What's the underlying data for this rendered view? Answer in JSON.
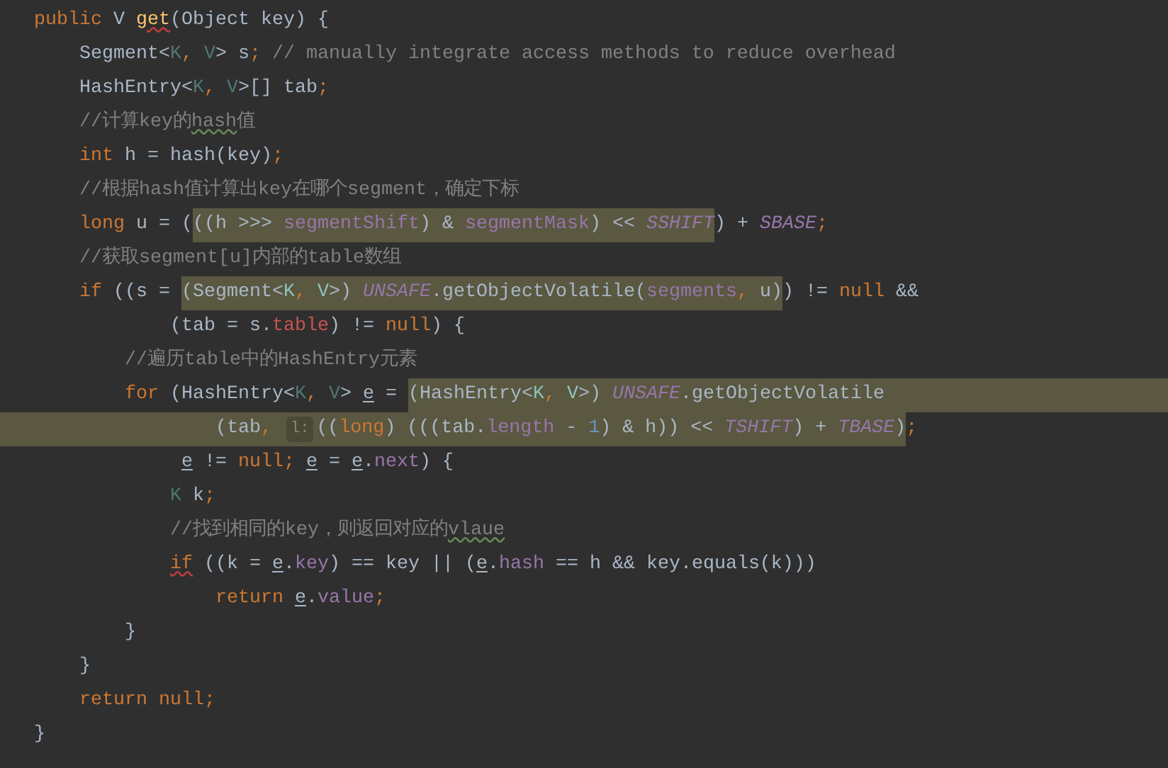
{
  "editor": {
    "lines": [
      {
        "tokens": [
          {
            "text": "public",
            "kind": "keyword"
          },
          {
            "text": " V ",
            "kind": "plain"
          },
          {
            "text": "get",
            "kind": "method_error"
          },
          {
            "text": "(Object key) {",
            "kind": "plain"
          }
        ]
      },
      {
        "tokens": [
          {
            "text": "    Segment<",
            "kind": "plain"
          },
          {
            "text": "K",
            "kind": "generic"
          },
          {
            "text": ", ",
            "kind": "keyword"
          },
          {
            "text": "V",
            "kind": "generic"
          },
          {
            "text": "> s",
            "kind": "plain"
          },
          {
            "text": ";",
            "kind": "keyword"
          },
          {
            "text": " // manually integrate access methods to reduce overhead",
            "kind": "comment"
          }
        ]
      },
      {
        "tokens": [
          {
            "text": "    HashEntry<",
            "kind": "plain"
          },
          {
            "text": "K",
            "kind": "generic"
          },
          {
            "text": ", ",
            "kind": "keyword"
          },
          {
            "text": "V",
            "kind": "generic"
          },
          {
            "text": ">[] tab",
            "kind": "plain"
          },
          {
            "text": ";",
            "kind": "keyword"
          }
        ]
      },
      {
        "tokens": [
          {
            "text": "    //计算key的",
            "kind": "comment"
          },
          {
            "text": "hash",
            "kind": "comment_typo"
          },
          {
            "text": "值",
            "kind": "comment"
          }
        ]
      },
      {
        "tokens": [
          {
            "text": "    int",
            "kind": "keyword"
          },
          {
            "text": " h = hash(key)",
            "kind": "plain"
          },
          {
            "text": ";",
            "kind": "keyword"
          }
        ]
      },
      {
        "tokens": [
          {
            "text": "    //根据hash值计算出key在哪个segment，确定下标",
            "kind": "comment"
          }
        ]
      },
      {
        "tokens": [
          {
            "text": "    long",
            "kind": "keyword"
          },
          {
            "text": " u = (",
            "kind": "plain"
          },
          {
            "kind": "highlight",
            "extends": false,
            "from_edge": false,
            "tokens": [
              {
                "text": "((h >>> ",
                "kind": "plain"
              },
              {
                "text": "segmentShift",
                "kind": "field"
              },
              {
                "text": ") & ",
                "kind": "plain"
              },
              {
                "text": "segmentMask",
                "kind": "field"
              },
              {
                "text": ") << ",
                "kind": "plain"
              },
              {
                "text": "SSHIFT",
                "kind": "static"
              }
            ]
          },
          {
            "text": ") + ",
            "kind": "plain"
          },
          {
            "text": "SBASE",
            "kind": "static"
          },
          {
            "text": ";",
            "kind": "keyword"
          }
        ]
      },
      {
        "tokens": [
          {
            "text": "    //获取segment[u]内部的table数组",
            "kind": "comment"
          }
        ]
      },
      {
        "tokens": [
          {
            "text": "    if",
            "kind": "keyword"
          },
          {
            "text": " ((s = ",
            "kind": "plain"
          },
          {
            "kind": "highlight",
            "extends": false,
            "from_edge": false,
            "tokens": [
              {
                "text": "(Segment<",
                "kind": "plain"
              },
              {
                "text": "K",
                "kind": "generic"
              },
              {
                "text": ", ",
                "kind": "keyword"
              },
              {
                "text": "V",
                "kind": "generic"
              },
              {
                "text": ">) ",
                "kind": "plain"
              },
              {
                "text": "UNSAFE",
                "kind": "static"
              },
              {
                "text": ".getObjectVolatile(",
                "kind": "plain"
              },
              {
                "text": "segments",
                "kind": "field"
              },
              {
                "text": ", ",
                "kind": "keyword"
              },
              {
                "text": "u)",
                "kind": "plain"
              }
            ]
          },
          {
            "text": ") != ",
            "kind": "plain"
          },
          {
            "text": "null",
            "kind": "keyword"
          },
          {
            "text": " &&",
            "kind": "plain"
          }
        ]
      },
      {
        "tokens": [
          {
            "text": "            (tab = s.",
            "kind": "plain"
          },
          {
            "text": "table",
            "kind": "field_red"
          },
          {
            "text": ") != ",
            "kind": "plain"
          },
          {
            "text": "null",
            "kind": "keyword"
          },
          {
            "text": ") {",
            "kind": "plain"
          }
        ]
      },
      {
        "tokens": [
          {
            "text": "        //遍历table中的HashEntry元素",
            "kind": "comment"
          }
        ]
      },
      {
        "tokens": [
          {
            "text": "        for",
            "kind": "keyword"
          },
          {
            "text": " (HashEntry<",
            "kind": "plain"
          },
          {
            "text": "K",
            "kind": "generic"
          },
          {
            "text": ", ",
            "kind": "keyword"
          },
          {
            "text": "V",
            "kind": "generic"
          },
          {
            "text": "> ",
            "kind": "plain"
          },
          {
            "text": "e",
            "kind": "variable"
          },
          {
            "text": " = ",
            "kind": "plain"
          },
          {
            "kind": "highlight",
            "extends": true,
            "from_edge": false,
            "tokens": [
              {
                "text": "(HashEntry<",
                "kind": "plain"
              },
              {
                "text": "K",
                "kind": "generic"
              },
              {
                "text": ", ",
                "kind": "keyword"
              },
              {
                "text": "V",
                "kind": "generic"
              },
              {
                "text": ">) ",
                "kind": "plain"
              },
              {
                "text": "UNSAFE",
                "kind": "static"
              },
              {
                "text": ".getObjectVolatile",
                "kind": "plain"
              }
            ]
          }
        ]
      },
      {
        "tokens": [
          {
            "kind": "highlight",
            "extends": false,
            "from_edge": true,
            "tokens": [
              {
                "text": "                (tab",
                "kind": "plain"
              },
              {
                "text": ", ",
                "kind": "keyword"
              },
              {
                "text": "l:",
                "kind": "hint"
              },
              {
                "text": "((",
                "kind": "plain"
              },
              {
                "text": "long",
                "kind": "keyword"
              },
              {
                "text": ") (((tab.",
                "kind": "plain"
              },
              {
                "text": "length",
                "kind": "field"
              },
              {
                "text": " - ",
                "kind": "plain"
              },
              {
                "text": "1",
                "kind": "number"
              },
              {
                "text": ") & h)) << ",
                "kind": "plain"
              },
              {
                "text": "TSHIFT",
                "kind": "static"
              },
              {
                "text": ") + ",
                "kind": "plain"
              },
              {
                "text": "TBASE",
                "kind": "static"
              },
              {
                "text": ")",
                "kind": "plain"
              }
            ]
          },
          {
            "text": ";",
            "kind": "keyword"
          }
        ]
      },
      {
        "tokens": [
          {
            "text": "             e",
            "kind": "variable"
          },
          {
            "text": " != ",
            "kind": "plain"
          },
          {
            "text": "null",
            "kind": "keyword"
          },
          {
            "text": "; ",
            "kind": "keyword"
          },
          {
            "text": "e",
            "kind": "variable"
          },
          {
            "text": " = ",
            "kind": "plain"
          },
          {
            "text": "e",
            "kind": "variable"
          },
          {
            "text": ".",
            "kind": "plain"
          },
          {
            "text": "next",
            "kind": "field"
          },
          {
            "text": ") {",
            "kind": "plain"
          }
        ]
      },
      {
        "tokens": [
          {
            "text": "            K",
            "kind": "generic"
          },
          {
            "text": " k",
            "kind": "plain"
          },
          {
            "text": ";",
            "kind": "keyword"
          }
        ]
      },
      {
        "tokens": [
          {
            "text": "            //找到相同的key，则返回对应的",
            "kind": "comment"
          },
          {
            "text": "vlaue",
            "kind": "comment_typo"
          }
        ]
      },
      {
        "tokens": [
          {
            "text": "            if",
            "kind": "keyword_warn"
          },
          {
            "text": " ((k = ",
            "kind": "plain"
          },
          {
            "text": "e",
            "kind": "variable"
          },
          {
            "text": ".",
            "kind": "plain"
          },
          {
            "text": "key",
            "kind": "field"
          },
          {
            "text": ") == key || (",
            "kind": "plain"
          },
          {
            "text": "e",
            "kind": "variable"
          },
          {
            "text": ".",
            "kind": "plain"
          },
          {
            "text": "hash",
            "kind": "field"
          },
          {
            "text": " == h && key.equals(k)))",
            "kind": "plain"
          }
        ]
      },
      {
        "tokens": [
          {
            "text": "                return",
            "kind": "keyword"
          },
          {
            "text": " e",
            "kind": "variable"
          },
          {
            "text": ".",
            "kind": "plain"
          },
          {
            "text": "value",
            "kind": "field"
          },
          {
            "text": ";",
            "kind": "keyword"
          }
        ]
      },
      {
        "tokens": [
          {
            "text": "        }",
            "kind": "plain"
          }
        ]
      },
      {
        "tokens": [
          {
            "text": "    }",
            "kind": "plain"
          }
        ]
      },
      {
        "tokens": [
          {
            "text": "    return null;",
            "kind": "keyword"
          }
        ]
      },
      {
        "tokens": [
          {
            "text": "}",
            "kind": "plain"
          }
        ]
      }
    ]
  }
}
